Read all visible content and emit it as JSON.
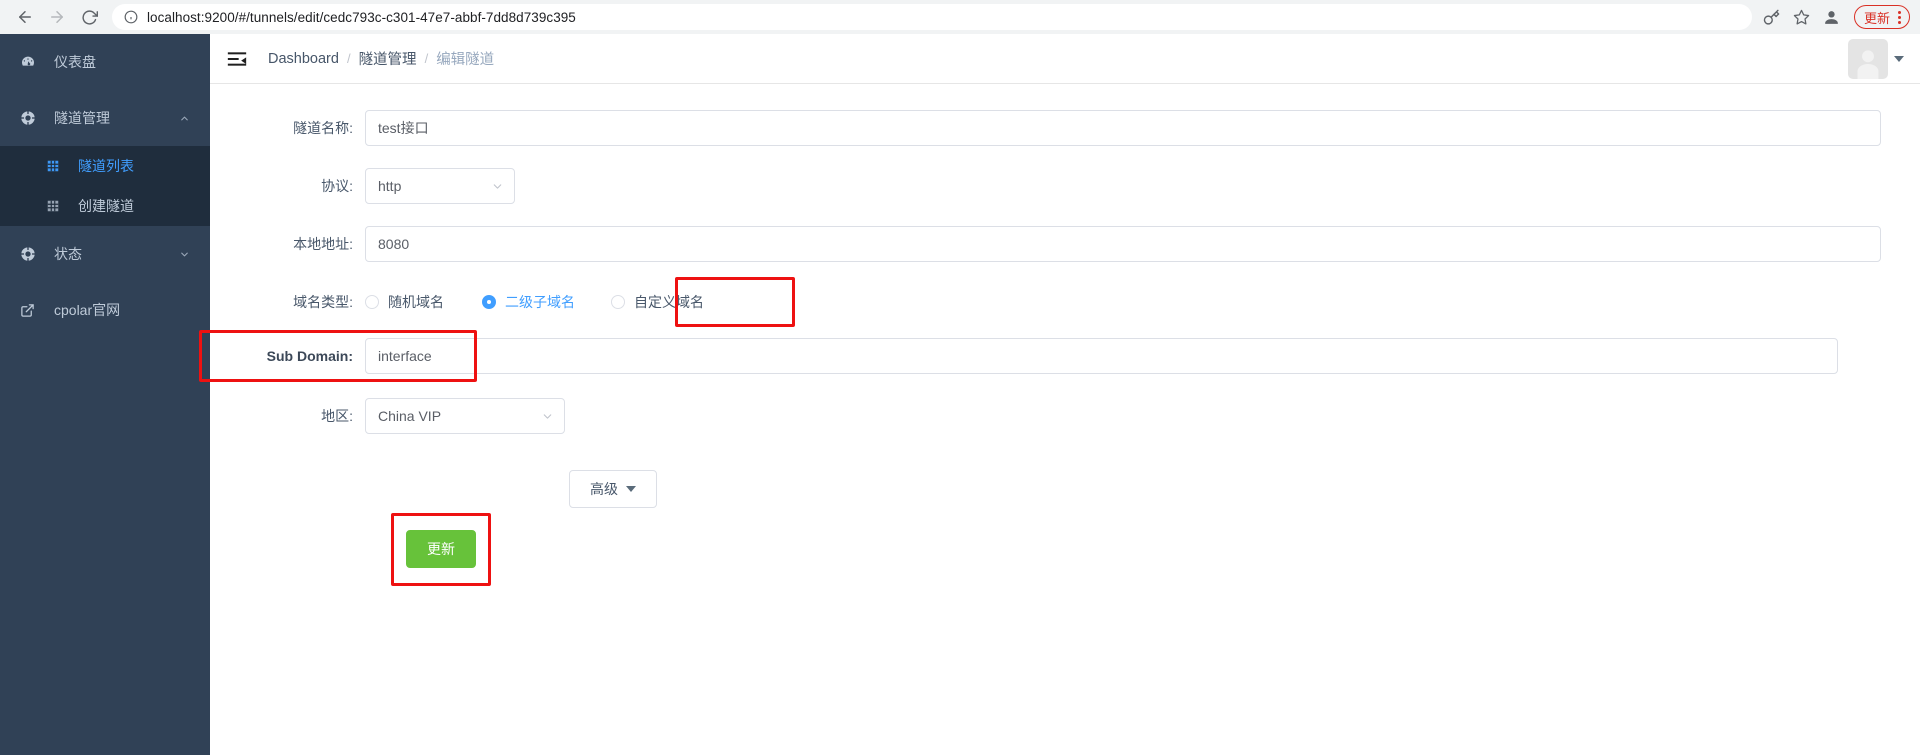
{
  "browser": {
    "back_icon": "back-arrow-icon",
    "forward_icon": "forward-arrow-icon",
    "reload_icon": "reload-icon",
    "site_info_icon": "site-info-icon",
    "url": "localhost:9200/#/tunnels/edit/cedc793c-c301-47e7-abbf-7dd8d739c395",
    "password_icon": "key-icon",
    "bookmark_icon": "star-icon",
    "profile_icon": "profile-avatar-icon",
    "update_label": "更新",
    "menu_icon": "three-dot-menu-icon",
    "update_accent": "#d93025"
  },
  "sidebar": {
    "background": "#304156",
    "submenu_background": "#1f2d3d",
    "active_color": "#409eff",
    "items": [
      {
        "label": "仪表盘",
        "icon": "dashboard-icon",
        "arrow": ""
      },
      {
        "label": "隧道管理",
        "icon": "tunnel-icon",
        "arrow": "chevron-up-icon"
      },
      {
        "label": "状态",
        "icon": "status-icon",
        "arrow": "chevron-down-icon"
      },
      {
        "label": "cpolar官网",
        "icon": "external-link-icon",
        "arrow": ""
      }
    ],
    "submenu": [
      {
        "label": "隧道列表",
        "icon": "table-icon",
        "active": true
      },
      {
        "label": "创建隧道",
        "icon": "table-icon",
        "active": false
      }
    ]
  },
  "navbar": {
    "collapse_icon": "hamburger-collapse-icon",
    "breadcrumb": [
      {
        "label": "Dashboard",
        "muted": false
      },
      {
        "label": "隧道管理",
        "muted": false
      },
      {
        "label": "编辑隧道",
        "muted": true
      }
    ],
    "separator": "/",
    "avatar_icon": "user-avatar-icon",
    "caret_icon": "caret-down-icon"
  },
  "form": {
    "tunnel_name": {
      "label": "隧道名称:",
      "value": "test接口"
    },
    "protocol": {
      "label": "协议:",
      "value": "http",
      "chevron": "chevron-down-icon"
    },
    "local_address": {
      "label": "本地地址:",
      "value": "8080"
    },
    "domain_type": {
      "label": "域名类型:",
      "options": [
        {
          "label": "随机域名",
          "checked": false
        },
        {
          "label": "二级子域名",
          "checked": true
        },
        {
          "label": "自定义域名",
          "checked": false
        }
      ]
    },
    "sub_domain": {
      "label": "Sub Domain:",
      "value": "interface"
    },
    "region": {
      "label": "地区:",
      "value": "China VIP",
      "chevron": "chevron-down-icon"
    },
    "advanced_button": {
      "label": "高级",
      "icon": "triangle-down-icon"
    },
    "submit_button": {
      "label": "更新",
      "color": "#67c23a"
    }
  },
  "annotations": {
    "highlight_color": "#ee1111",
    "boxes": [
      {
        "name": "subdomain-radio-highlight"
      },
      {
        "name": "sub-domain-field-highlight"
      },
      {
        "name": "update-button-highlight"
      }
    ]
  }
}
